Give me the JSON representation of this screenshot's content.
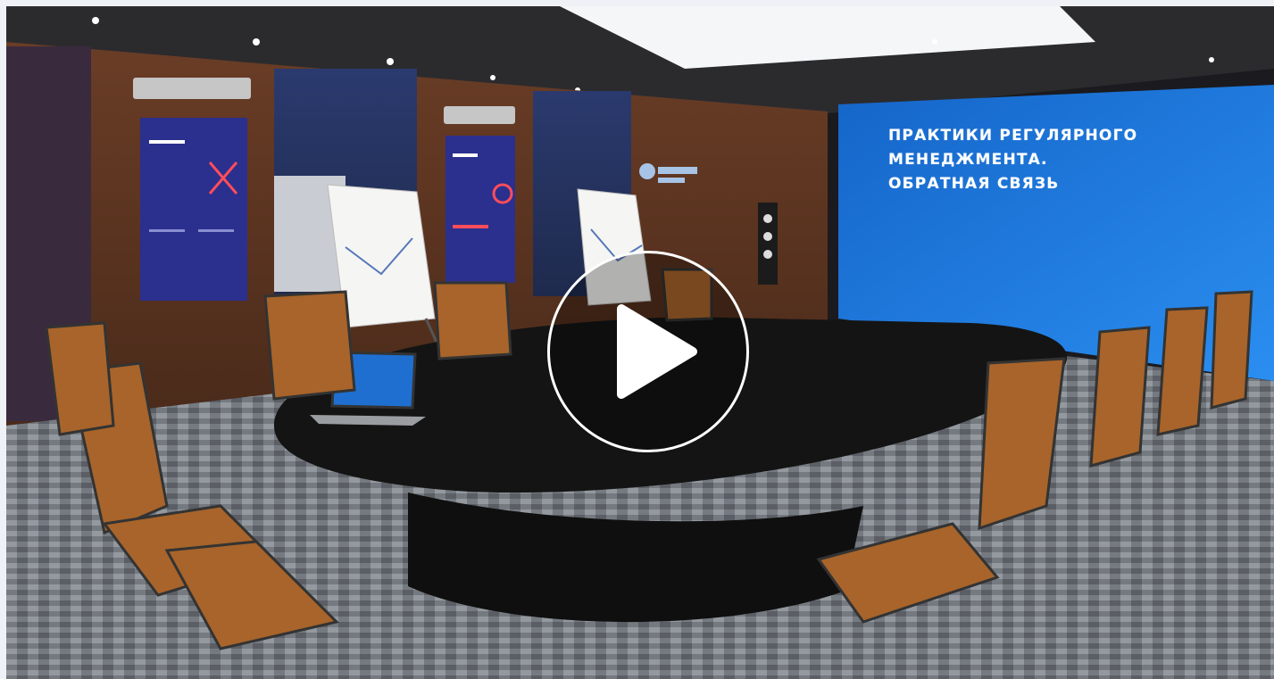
{
  "video": {
    "screen_lines": [
      "ПРАКТИКИ РЕГУЛЯРНОГО",
      "МЕНЕДЖМЕНТА.",
      "ОБРАТНАЯ СВЯЗЬ"
    ],
    "play_icon": "play-icon"
  },
  "colors": {
    "screen_blue": "#1a74d6",
    "wall_wood": "#5a3420",
    "chair_leather": "#a8642a",
    "table": "#141414",
    "poster_navy": "#2b2f8e"
  }
}
